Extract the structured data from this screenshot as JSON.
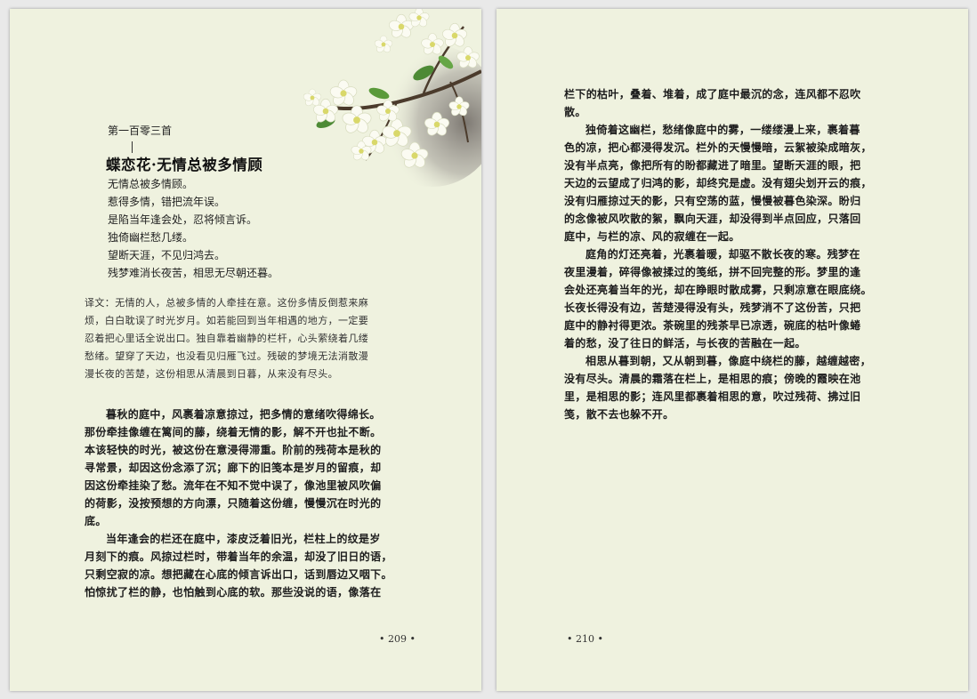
{
  "left_page": {
    "poem_number": "第一百零三首",
    "title_divider": "|",
    "poem_title": "蝶恋花·无情总被多情顾",
    "poem_lines": [
      "无情总被多情顾。",
      "惹得多情，错把流年误。",
      "是陷当年逢会处，忍将倾言诉。",
      "独倚幽栏愁几缕。",
      "望断天涯，不见归鸿去。",
      "残梦难消长夜苦，相思无尽朝还暮。"
    ],
    "translation_lines": [
      "译文：无情的人，总被多情的人牵挂在意。这份多情反倒惹来麻",
      "烦，白白耽误了时光岁月。如若能回到当年相遇的地方，一定要",
      "忍着把心里话全说出口。独自靠着幽静的栏杆，心头萦绕着几缕",
      "愁绪。望穿了天边，也没看见归雁飞过。残破的梦境无法消散漫",
      "漫长夜的苦楚，这份相思从清晨到日暮，从来没有尽头。"
    ],
    "prose_lines": [
      "暮秋的庭中，风裹着凉意掠过，把多情的意绪吹得绵长。",
      "那份牵挂像缠在篱间的藤，绕着无情的影，解不开也扯不断。",
      "本该轻快的时光，被这份在意浸得滞重。阶前的残荷本是秋的",
      "寻常景，却因这份念添了沉；廊下的旧笺本是岁月的留痕，却",
      "因这份牵挂染了愁。流年在不知不觉中误了，像池里被风吹偏",
      "的荷影，没按预想的方向漂，只随着这份缠，慢慢沉在时光的",
      "底。",
      "当年逢会的栏还在庭中，漆皮泛着旧光，栏柱上的纹是岁",
      "月刻下的痕。风掠过栏时，带着当年的余温，却没了旧日的语，",
      "只剩空寂的凉。想把藏在心底的倾言诉出口，话到唇边又咽下。",
      "怕惊扰了栏的静，也怕触到心底的软。那些没说的语，像落在"
    ],
    "prose_indent_rows": [
      0,
      7
    ],
    "page_number": "• 209 •"
  },
  "right_page": {
    "prose_lines": [
      "栏下的枯叶，叠着、堆着，成了庭中最沉的念，连风都不忍吹",
      "散。",
      "独倚着这幽栏，愁绪像庭中的雾，一缕缕漫上来，裹着暮",
      "色的凉，把心都浸得发沉。栏外的天慢慢暗，云絮被染成暗灰，",
      "没有半点亮，像把所有的盼都藏进了暗里。望断天涯的眼，把",
      "天边的云望成了归鸿的影，却终究是虚。没有翅尖划开云的痕，",
      "没有归雁掠过天的影，只有空荡的蓝，慢慢被暮色染深。盼归",
      "的念像被风吹散的絮，飘向天涯，却没得到半点回应，只落回",
      "庭中，与栏的凉、风的寂缠在一起。",
      "庭角的灯还亮着，光裹着暖，却驱不散长夜的寒。残梦在",
      "夜里漫着，碎得像被揉过的笺纸，拼不回完整的形。梦里的逢",
      "会处还亮着当年的光，却在睁眼时散成雾，只剩凉意在眼底绕。",
      "长夜长得没有边，苦楚浸得没有头，残梦消不了这份苦，只把",
      "庭中的静衬得更浓。茶碗里的残茶早已凉透，碗底的枯叶像蜷",
      "着的愁，没了往日的鲜活，与长夜的苦融在一起。",
      "相思从暮到朝，又从朝到暮，像庭中绕栏的藤，越缠越密，",
      "没有尽头。清晨的霜落在栏上，是相思的痕；傍晚的霞映在池",
      "里，是相思的影；连风里都裹着相思的意，吹过残荷、拂过旧",
      "笺，散不去也躲不开。"
    ],
    "prose_indent_rows": [
      2,
      9,
      15
    ],
    "page_number": "• 210 •"
  },
  "colors": {
    "page_background": "#eff2df",
    "desk_background": "#e9e9e9",
    "text": "#1c1c1c"
  },
  "decoration": {
    "image": "white flower branch illustration"
  }
}
